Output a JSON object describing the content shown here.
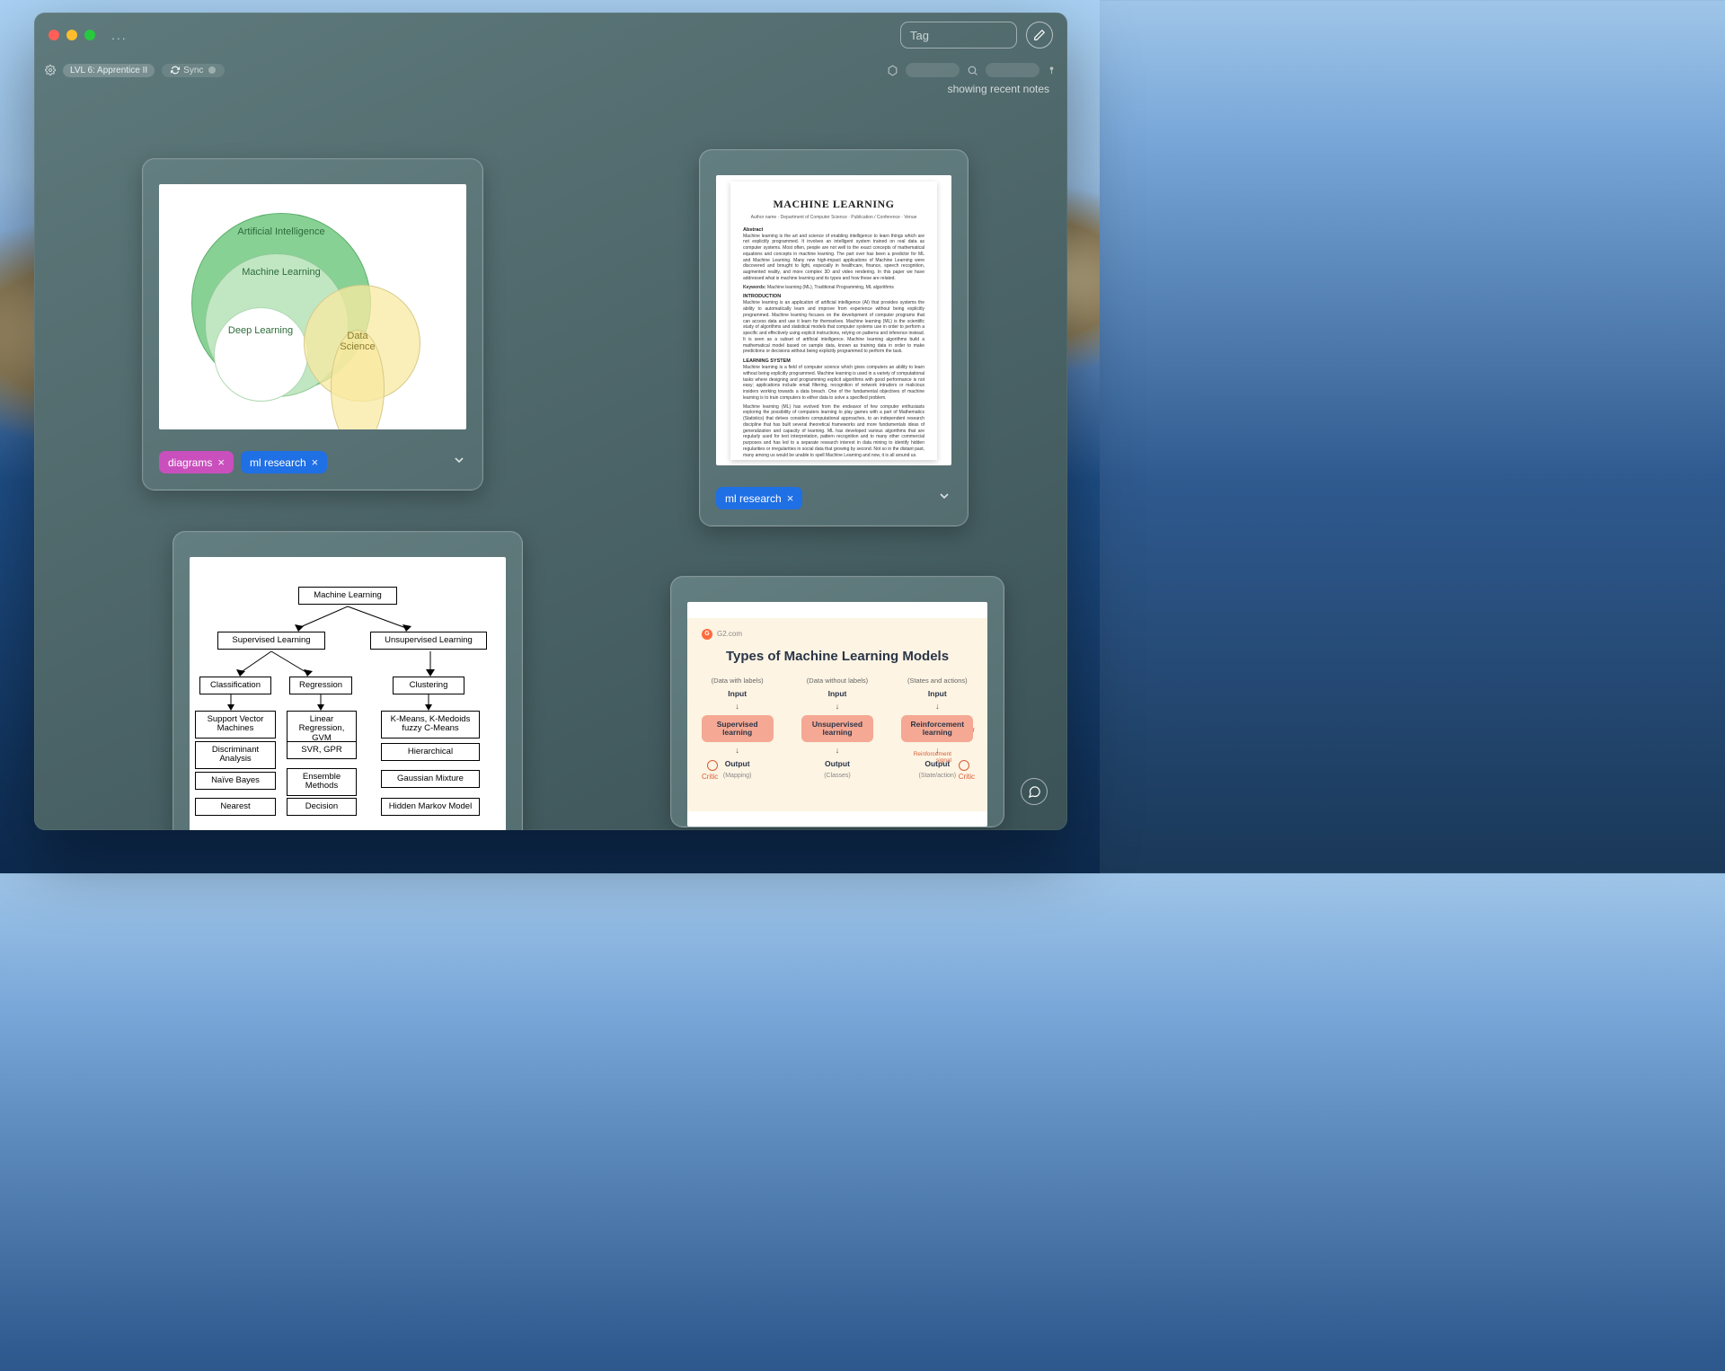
{
  "titlebar": {
    "more": "...",
    "tag_placeholder": "Tag"
  },
  "toolbar": {
    "level_badge": "LVL 6: Apprentice II",
    "sync_label": "Sync"
  },
  "meta": {
    "status": "showing recent notes"
  },
  "cards": {
    "venn": {
      "labels": {
        "ai": "Artificial Intelligence",
        "ml": "Machine Learning",
        "dl": "Deep Learning",
        "ds": "Data Science"
      },
      "tags": [
        "diagrams",
        "ml research"
      ]
    },
    "paper": {
      "title": "MACHINE LEARNING",
      "keywords_label": "Keywords:",
      "keywords": "Machine learning (ML), Traditional Programming, ML algorithms",
      "section1": "INTRODUCTION",
      "section2": "LEARNING SYSTEM",
      "tags": [
        "ml research"
      ]
    },
    "flow": {
      "root": "Machine Learning",
      "branches": {
        "supervised": {
          "label": "Supervised Learning",
          "sub": {
            "classification": {
              "label": "Classification",
              "items": [
                "Support Vector Machines",
                "Discriminant Analysis",
                "Naïve Bayes",
                "Nearest"
              ]
            },
            "regression": {
              "label": "Regression",
              "items": [
                "Linear Regression, GVM",
                "SVR, GPR",
                "Ensemble Methods",
                "Decision"
              ]
            }
          }
        },
        "unsupervised": {
          "label": "Unsupervised Learning",
          "sub": {
            "clustering": {
              "label": "Clustering",
              "items": [
                "K-Means, K-Medoids fuzzy C-Means",
                "Hierarchical",
                "Gaussian Mixture",
                "Hidden Markov Model"
              ]
            }
          }
        }
      }
    },
    "g2": {
      "source": "G2.com",
      "title": "Types of Machine Learning Models",
      "columns": [
        {
          "subtitle": "(Data with labels)",
          "input": "Input",
          "box": "Supervised learning",
          "output": "Output",
          "outsub": "(Mapping)"
        },
        {
          "subtitle": "(Data without labels)",
          "input": "Input",
          "box": "Unsupervised learning",
          "output": "Output",
          "outsub": "(Classes)"
        },
        {
          "subtitle": "(States and actions)",
          "input": "Input",
          "box": "Reinforcement learning",
          "output": "Output",
          "outsub": "(State/action)"
        }
      ],
      "side_labels": {
        "error": "Error",
        "critic": "Critic",
        "reinf": "Reinforcement signal"
      }
    }
  },
  "colors": {
    "tag_magenta": "#c94fbd",
    "tag_blue": "#1f6fe5"
  }
}
